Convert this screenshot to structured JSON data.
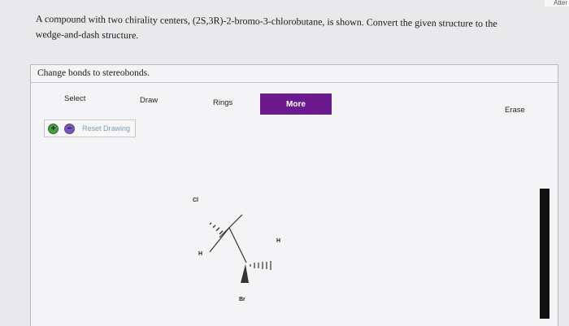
{
  "header": {
    "corner_text": "Atter"
  },
  "question": {
    "line1": "A compound with two chirality centers, (2S,3R)-2-bromo-3-chlorobutane, is shown. Convert the given structure to the",
    "line2": "wedge-and-dash structure."
  },
  "panel": {
    "instruction": "Change bonds to stereobonds.",
    "toolbar": {
      "select": "Select",
      "draw": "Draw",
      "rings": "Rings",
      "more": "More",
      "erase": "Erase"
    },
    "zoom": {
      "plus": "+",
      "minus": "−",
      "reset": "Reset Drawing"
    },
    "molecule": {
      "atoms": {
        "cl": "Cl",
        "h_right": "H",
        "h_left": "H",
        "br": "Br"
      }
    }
  },
  "colors": {
    "more_button": "#6a1a8e",
    "plus": "#3aa63a",
    "minus": "#7a52c8"
  }
}
